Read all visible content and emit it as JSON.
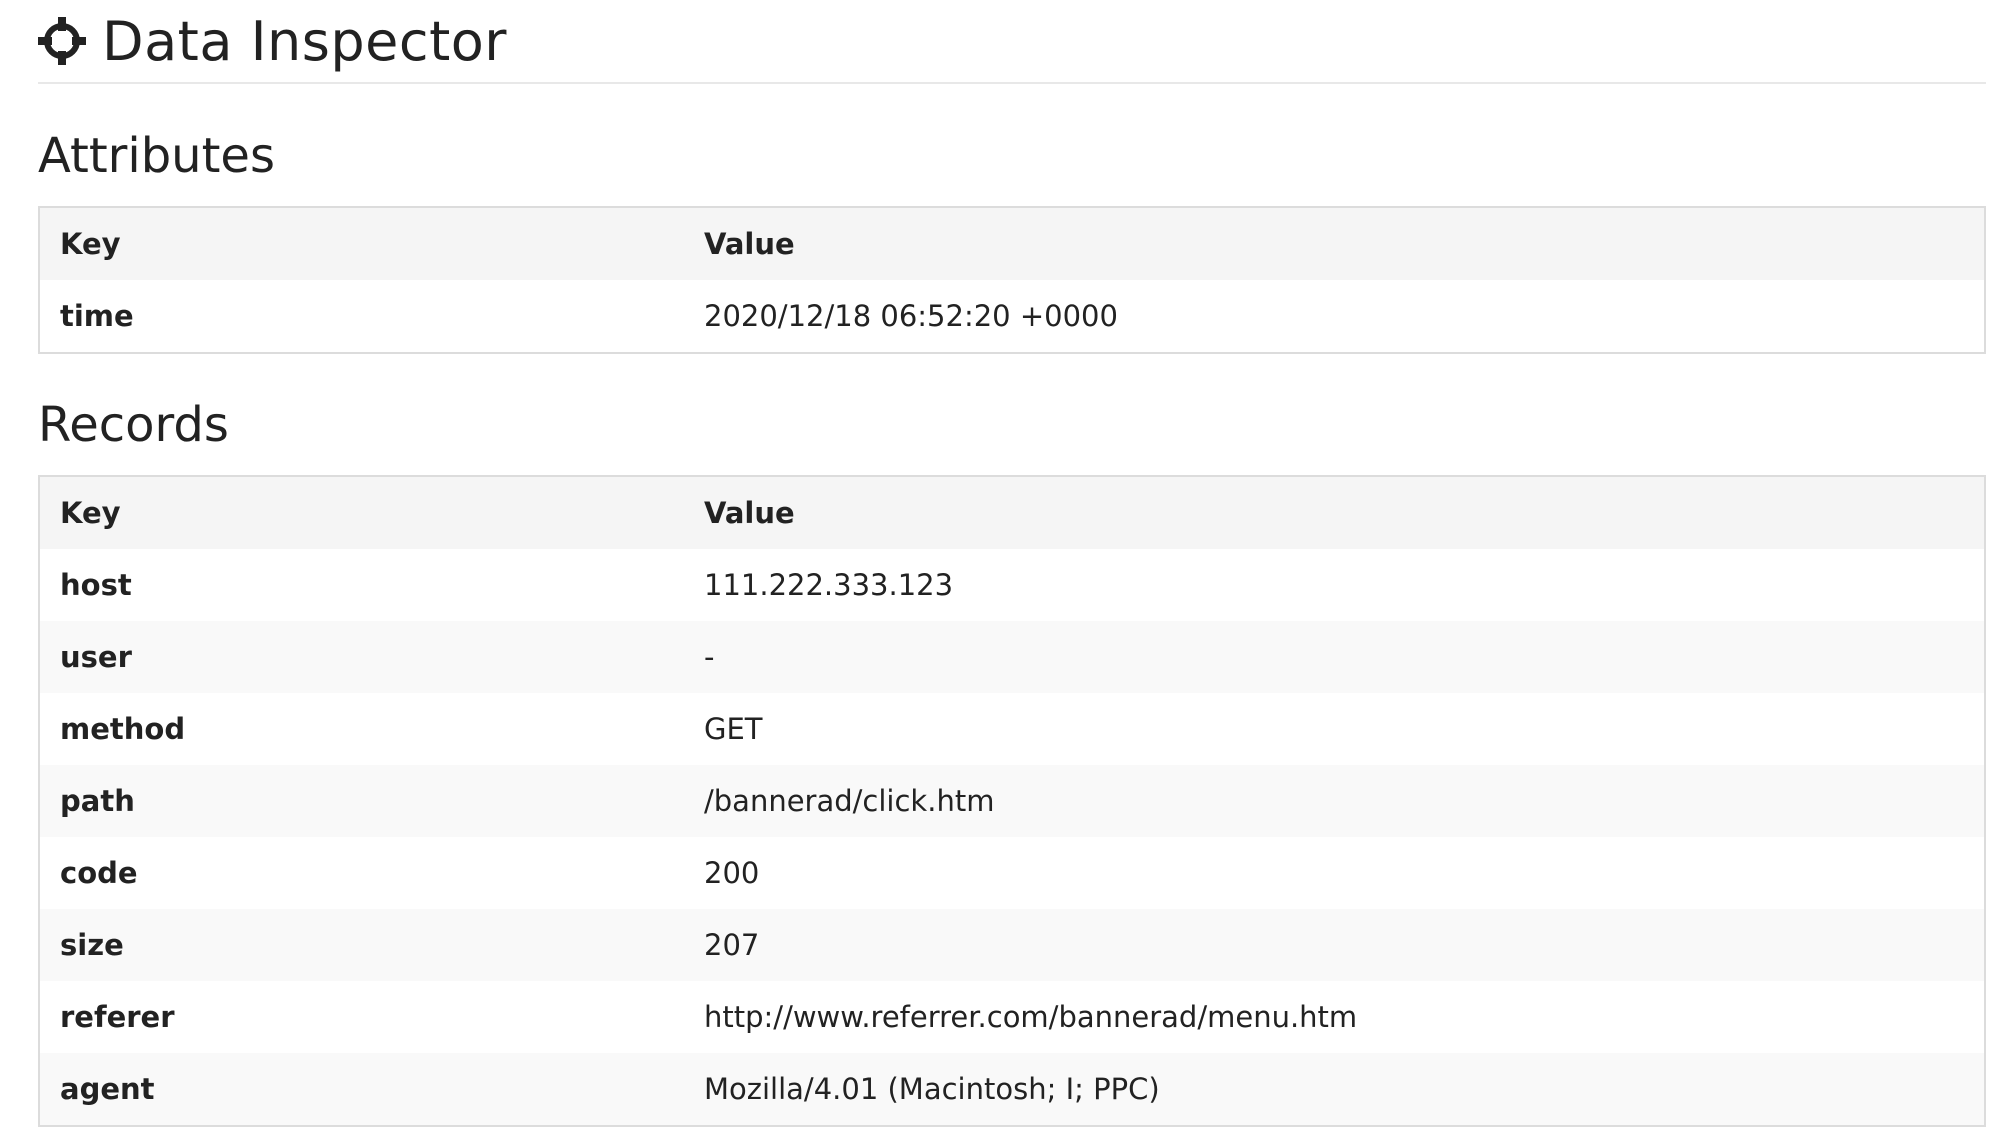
{
  "header": {
    "title": "Data Inspector",
    "icon": "crosshair-icon"
  },
  "attributes": {
    "title": "Attributes",
    "columns": [
      "Key",
      "Value"
    ],
    "rows": [
      {
        "key": "time",
        "value": "2020/12/18 06:52:20 +0000"
      }
    ]
  },
  "records": {
    "title": "Records",
    "columns": [
      "Key",
      "Value"
    ],
    "rows": [
      {
        "key": "host",
        "value": "111.222.333.123"
      },
      {
        "key": "user",
        "value": "-"
      },
      {
        "key": "method",
        "value": "GET"
      },
      {
        "key": "path",
        "value": "/bannerad/click.htm"
      },
      {
        "key": "code",
        "value": "200"
      },
      {
        "key": "size",
        "value": "207"
      },
      {
        "key": "referer",
        "value": "http://www.referrer.com/bannerad/menu.htm"
      },
      {
        "key": "agent",
        "value": "Mozilla/4.01 (Macintosh; I; PPC)"
      }
    ]
  }
}
